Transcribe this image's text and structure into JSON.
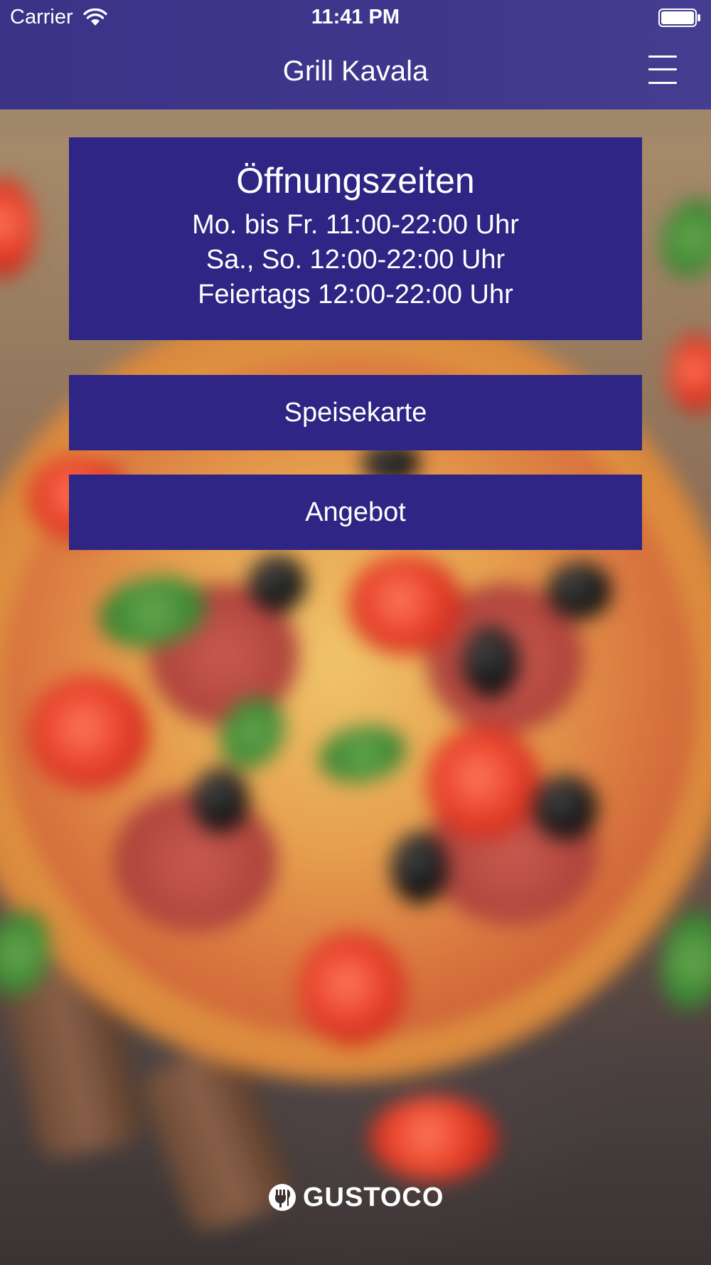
{
  "status_bar": {
    "carrier": "Carrier",
    "time": "11:41 PM"
  },
  "nav": {
    "title": "Grill Kavala",
    "menu_icon": "hamburger-menu-icon"
  },
  "hours": {
    "title": "Öffnungszeiten",
    "lines": [
      "Mo. bis Fr. 11:00-22:00 Uhr",
      "Sa., So. 12:00-22:00 Uhr",
      "Feiertags 12:00-22:00 Uhr"
    ]
  },
  "buttons": {
    "menu_label": "Speisekarte",
    "offer_label": "Angebot"
  },
  "footer": {
    "brand": "GUSTOCO",
    "logo_icon": "plug-fork-knife-icon"
  },
  "colors": {
    "nav_background": "#3e378c",
    "panel_background": "#2e2584",
    "text": "#ffffff"
  }
}
